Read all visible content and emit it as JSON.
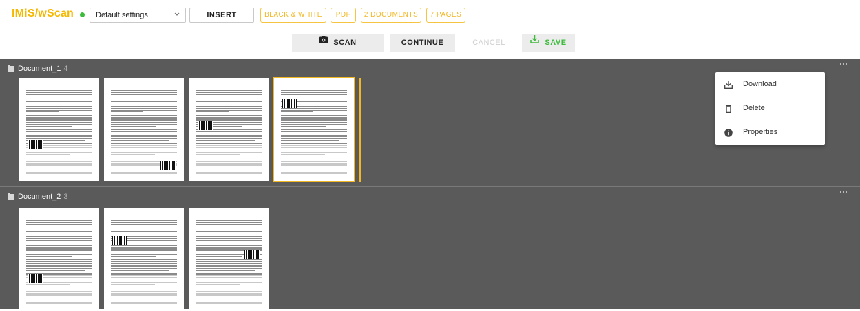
{
  "app": {
    "title": "IMiS/wScan",
    "status_color": "#3dbb3d",
    "brand_color": "#f5b800"
  },
  "toolbar": {
    "settings_value": "Default settings",
    "insert_label": "INSERT",
    "chips": [
      "BLACK & WHITE",
      "PDF",
      "2 DOCUMENTS",
      "7 PAGES"
    ]
  },
  "actions": {
    "scan_label": "SCAN",
    "continue_label": "CONTINUE",
    "cancel_label": "CANCEL",
    "save_label": "SAVE"
  },
  "documents": [
    {
      "name": "Document_1",
      "page_count": "4",
      "selected_page": 4
    },
    {
      "name": "Document_2",
      "page_count": "3"
    }
  ],
  "context_menu": {
    "items": [
      {
        "label": "Download",
        "icon": "download-icon"
      },
      {
        "label": "Delete",
        "icon": "trash-icon"
      },
      {
        "label": "Properties",
        "icon": "info-icon"
      }
    ]
  },
  "colors": {
    "accent": "#f2b824",
    "save_green": "#3dbb3d",
    "section_bg": "#5a5a5a"
  }
}
